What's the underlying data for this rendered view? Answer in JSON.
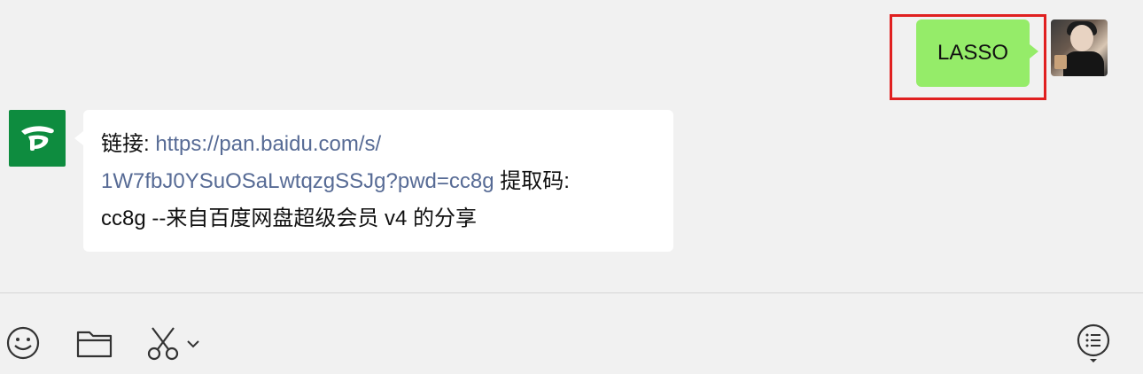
{
  "outgoing_message": {
    "text": "LASSO",
    "bubble_color": "#95ec69",
    "highlight_color": "#e02020"
  },
  "incoming_message": {
    "label": "链接:",
    "link_line1": "https://pan.baidu.com/s/",
    "link_line2": "1W7fbJ0YSuOSaLwtqzgSSJg?pwd=cc8g",
    "code_label": "提取码:",
    "line3": "cc8g --来自百度网盘超级会员 v4 的分享",
    "link_color": "#576b95"
  },
  "toolbar": {
    "icons": [
      "emoji-icon",
      "folder-icon",
      "scissors-icon",
      "chevron-down-icon",
      "chat-history-icon"
    ]
  }
}
